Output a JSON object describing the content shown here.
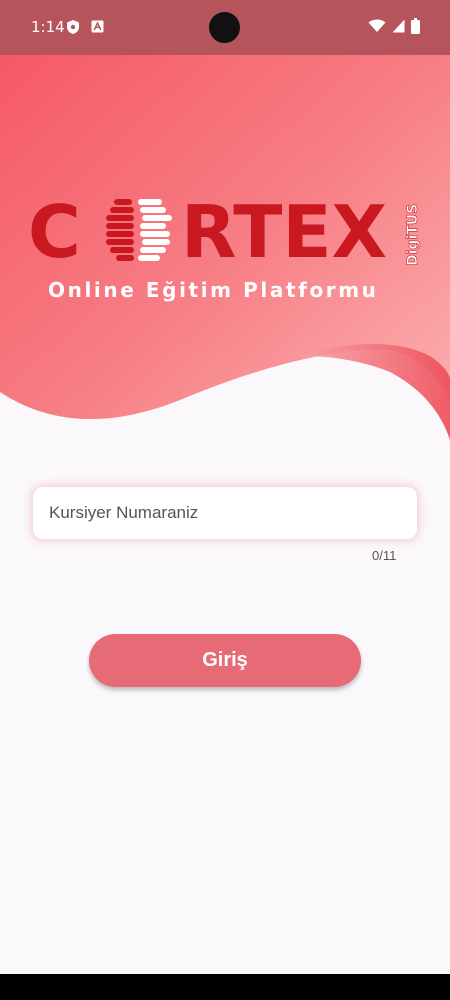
{
  "status_bar": {
    "time": "1:14",
    "icons": [
      "shield-icon",
      "a-icon",
      "wifi-icon",
      "signal-icon",
      "battery-icon"
    ]
  },
  "logo": {
    "brand_c": "C",
    "brand_rest": "RTEX",
    "sub_brand": "DigiTUS",
    "slogan": "Online Eğitim Platformu"
  },
  "login_form": {
    "input_placeholder": "Kursiyer Numaraniz",
    "input_value": "",
    "char_counter": "0/11",
    "submit_label": "Giriş"
  },
  "colors": {
    "brand_red": "#c9181f",
    "header_gradient_start": "#f45964",
    "header_gradient_end": "#f9a0a2",
    "button": "#e66b76",
    "background": "#faf8fa"
  }
}
